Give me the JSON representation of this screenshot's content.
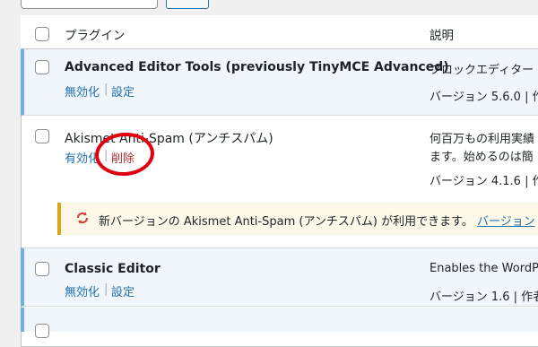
{
  "table_header": {
    "plugin_col": "プラグイン",
    "desc_col": "説明"
  },
  "plugins": [
    {
      "name": "Advanced Editor Tools (previously TinyMCE Advanced)",
      "actions": [
        "無効化",
        "設定"
      ],
      "description": "ブロックエディター",
      "version": "バージョン 5.6.0 | 作"
    },
    {
      "name": "Akismet Anti-Spam (アンチスパム)",
      "actions": [
        "有効化",
        "削除"
      ],
      "description_lines": [
        "何百万もの利用実績",
        "ます。始めるのは簡"
      ],
      "version": "バージョン 4.1.6 | 作"
    },
    {
      "name": "Classic Editor",
      "actions": [
        "無効化",
        "設定"
      ],
      "description": "Enables the WordPr",
      "version": "バージョン 1.6 | 作者"
    }
  ],
  "update_notice": {
    "text": "新バージョンの Akismet Anti-Spam (アンチスパム) が利用できます。",
    "link": "バージョン"
  },
  "colors": {
    "accent": "#2271b1",
    "delete": "#b32d2e",
    "active_border": "#72aee6",
    "notice_border": "#dba617",
    "annotation_circle": "#e0000f"
  }
}
